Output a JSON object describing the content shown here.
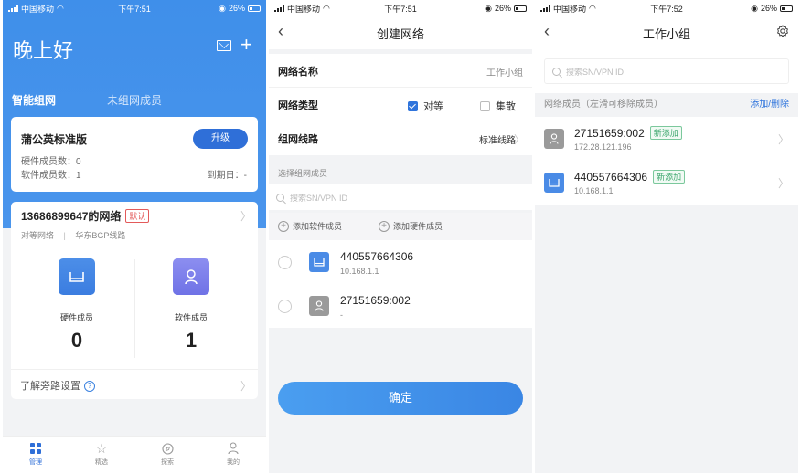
{
  "status_bars": [
    {
      "carrier": "中国移动",
      "time": "下午7:51",
      "battery": "26%"
    },
    {
      "carrier": "中国移动",
      "time": "下午7:51",
      "battery": "26%"
    },
    {
      "carrier": "中国移动",
      "time": "下午7:52",
      "battery": "26%"
    }
  ],
  "home": {
    "greeting": "晚上好",
    "tabs": [
      "智能组网",
      "未组网成员"
    ],
    "plan": {
      "title": "蒲公英标准版",
      "upgrade_label": "升级",
      "hardware_members": "硬件成员数：0",
      "software_members": "软件成员数：1",
      "expire": "到期日：-"
    },
    "network": {
      "title": "13686899647的网络",
      "default_badge": "默认",
      "type": "对等网络",
      "separator": "|",
      "line": "华东BGP线路",
      "hardware_label": "硬件成员",
      "hardware_count": "0",
      "software_label": "软件成员",
      "software_count": "1",
      "bypass_label": "了解旁路设置"
    },
    "tabbar": [
      {
        "label": "管理",
        "icon": "grid-icon",
        "active": true
      },
      {
        "label": "精选",
        "icon": "star-icon",
        "active": false
      },
      {
        "label": "探索",
        "icon": "compass-icon",
        "active": false
      },
      {
        "label": "我的",
        "icon": "person-icon",
        "active": false
      }
    ]
  },
  "create": {
    "title": "创建网络",
    "name_label": "网络名称",
    "name_value": "工作小组",
    "type_label": "网络类型",
    "type_options": [
      {
        "label": "对等",
        "checked": true
      },
      {
        "label": "集散",
        "checked": false
      }
    ],
    "line_label": "组网线路",
    "line_value": "标准线路",
    "members_caption": "选择组网成员",
    "search_placeholder": "搜索SN/VPN ID",
    "add_software": "添加软件成员",
    "add_hardware": "添加硬件成员",
    "candidates": [
      {
        "name": "440557664306",
        "ip": "10.168.1.1",
        "icon": "router-icon"
      },
      {
        "name": "27151659:002",
        "ip": "-",
        "icon": "person-icon"
      }
    ],
    "confirm_label": "确定"
  },
  "group": {
    "title": "工作小组",
    "search_placeholder": "搜索SN/VPN ID",
    "members_caption": "网络成员（左滑可移除成员）",
    "add_remove": "添加/删除",
    "members": [
      {
        "name": "27151659:002",
        "ip": "172.28.121.196",
        "tag": "新添加",
        "icon": "person-icon"
      },
      {
        "name": "440557664306",
        "ip": "10.168.1.1",
        "tag": "新添加",
        "icon": "router-icon"
      }
    ]
  },
  "colors": {
    "header_blue": "#4a95ec",
    "accent": "#2f74dc",
    "new_tag_green": "#3aa56b",
    "default_badge_red": "#e35a5a"
  }
}
